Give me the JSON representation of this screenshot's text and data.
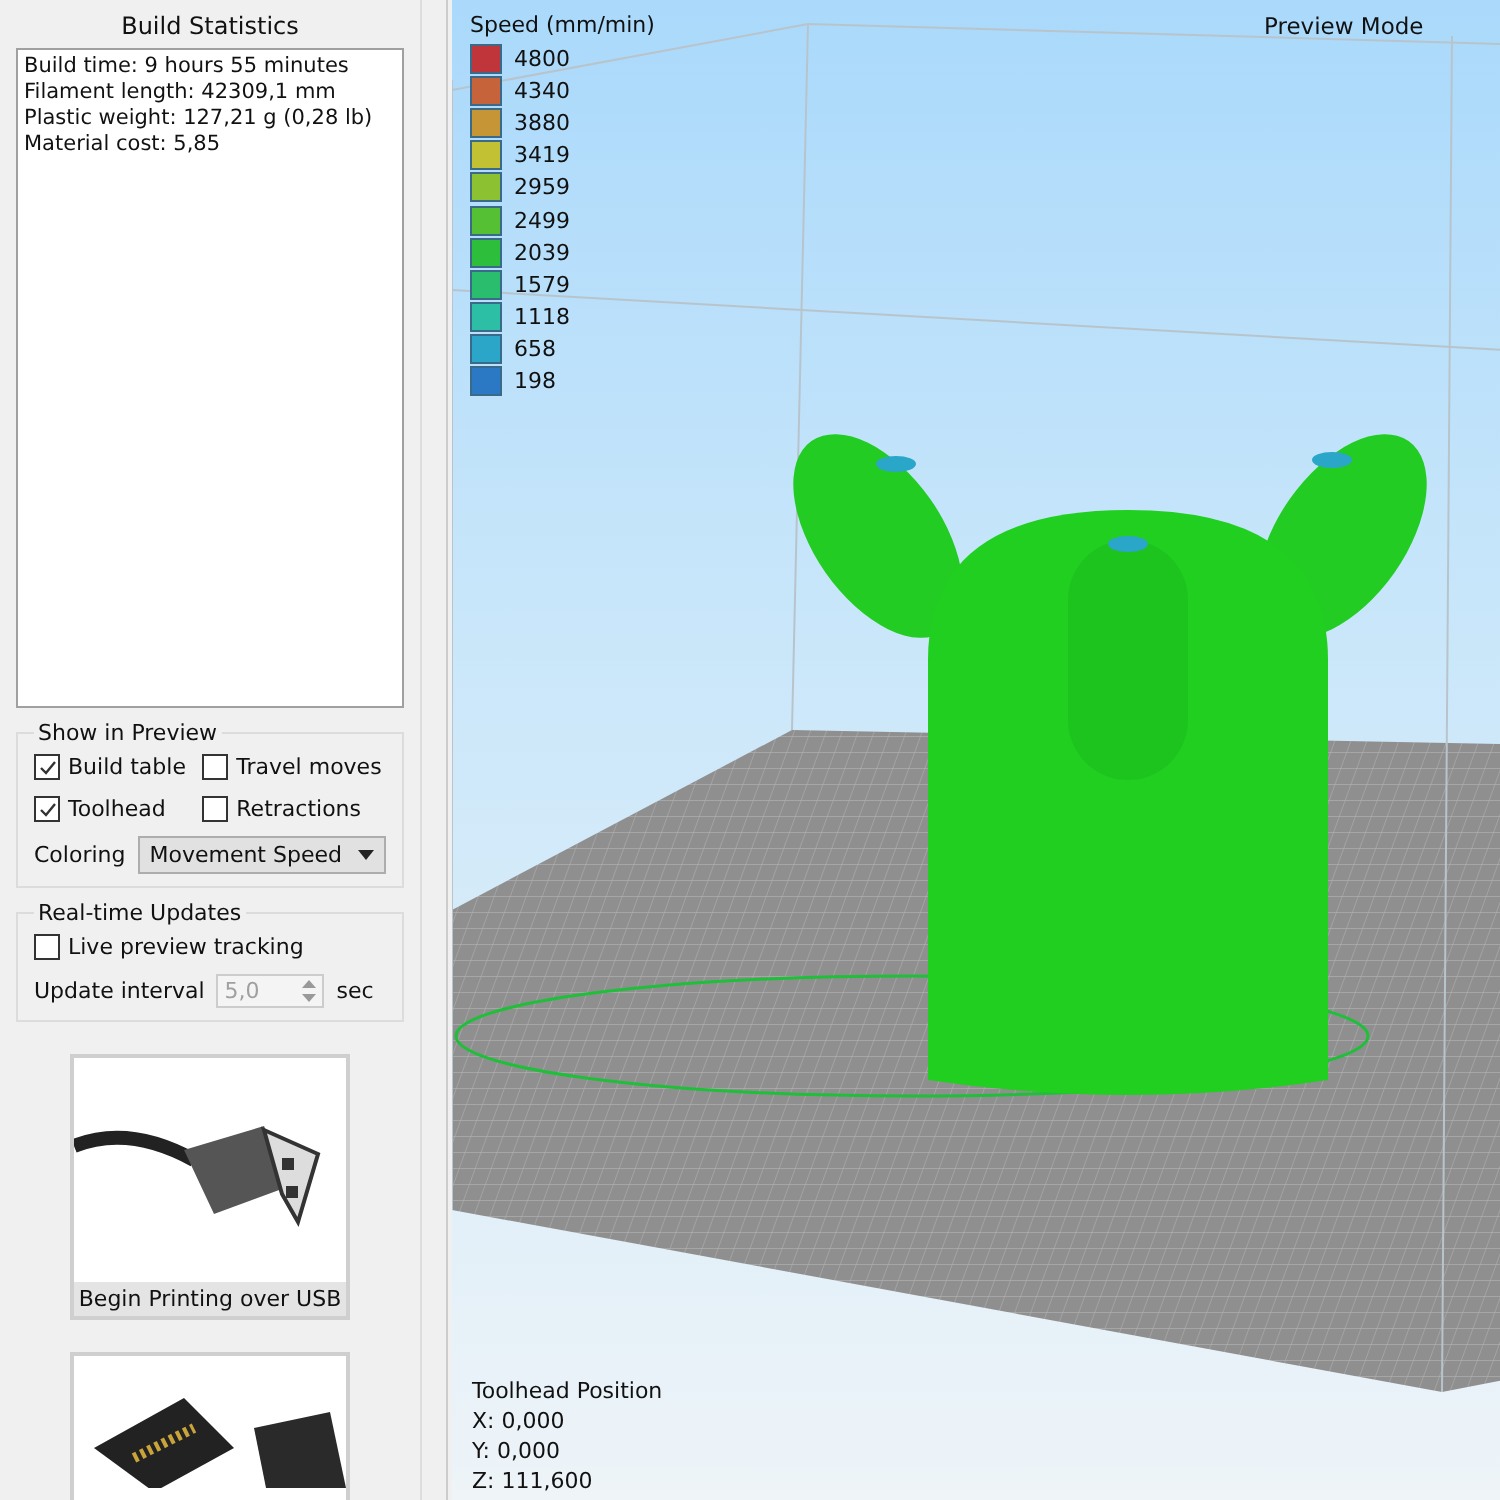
{
  "sidebar": {
    "title": "Build Statistics",
    "statistics": [
      "Build time: 9 hours 55 minutes",
      "Filament length: 42309,1 mm",
      "Plastic weight: 127,21 g (0,28 lb)",
      "Material cost: 5,85"
    ],
    "show_in_preview": {
      "title": "Show in Preview",
      "options": [
        {
          "label": "Build table",
          "checked": true
        },
        {
          "label": "Travel moves",
          "checked": false
        },
        {
          "label": "Toolhead",
          "checked": true
        },
        {
          "label": "Retractions",
          "checked": false
        }
      ],
      "coloring": {
        "label": "Coloring",
        "value": "Movement Speed"
      }
    },
    "realtime_updates": {
      "title": "Real-time Updates",
      "live_tracking": {
        "label": "Live preview tracking",
        "checked": false
      },
      "update_interval": {
        "label": "Update interval",
        "value": "5,0",
        "unit": "sec",
        "disabled": true
      }
    },
    "print_buttons": [
      {
        "kind": "usb",
        "label": "Begin Printing over USB"
      },
      {
        "kind": "sd"
      }
    ]
  },
  "viewport": {
    "mode": "Preview Mode",
    "legend": {
      "title": "Speed (mm/min)",
      "items": [
        {
          "value": "4800",
          "color": "#c0353a"
        },
        {
          "value": "4340",
          "color": "#c7633a"
        },
        {
          "value": "3880",
          "color": "#c59536"
        },
        {
          "value": "3419",
          "color": "#c2c133"
        },
        {
          "value": "2959",
          "color": "#8cc232"
        },
        {
          "value": "2499",
          "color": "#55c034"
        },
        {
          "value": "2039",
          "color": "#2dbf3c"
        },
        {
          "value": "1579",
          "color": "#2abd6e"
        },
        {
          "value": "1118",
          "color": "#2cbfa6"
        },
        {
          "value": "658",
          "color": "#2ba6c9"
        },
        {
          "value": "198",
          "color": "#2b78c4"
        }
      ]
    },
    "toolhead": {
      "title": "Toolhead Position",
      "lines": [
        "X: 0,000",
        "Y: 0,000",
        "Z: 111,600"
      ]
    }
  }
}
